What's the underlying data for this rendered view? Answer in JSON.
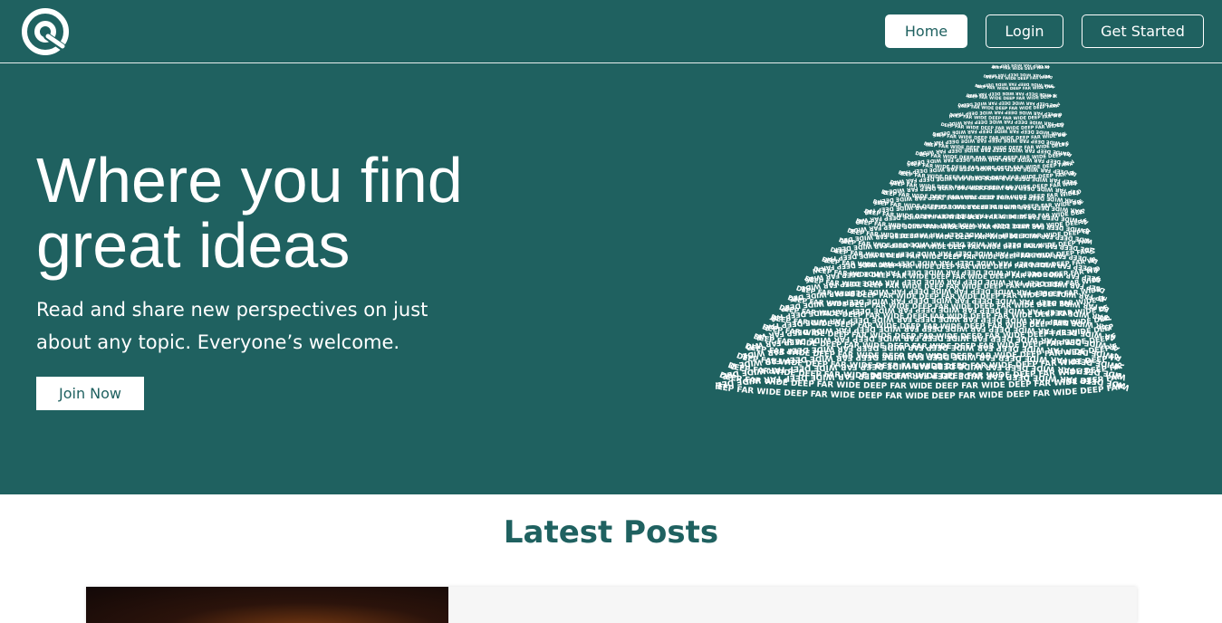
{
  "nav": {
    "home_label": "Home",
    "login_label": "Login",
    "get_started_label": "Get Started"
  },
  "hero": {
    "headline_line1": "Where you find",
    "headline_line2": "great ideas",
    "subtitle_line1": "Read and share new perspectives on just",
    "subtitle_line2": "about any topic. Everyone’s welcome.",
    "join_label": "Join Now",
    "cone_text": "DEEP FAR WIDE"
  },
  "latest": {
    "title": "Latest Posts"
  },
  "colors": {
    "brand": "#1f6160",
    "white": "#ffffff"
  },
  "icons": {
    "logo": "logo-icon"
  }
}
